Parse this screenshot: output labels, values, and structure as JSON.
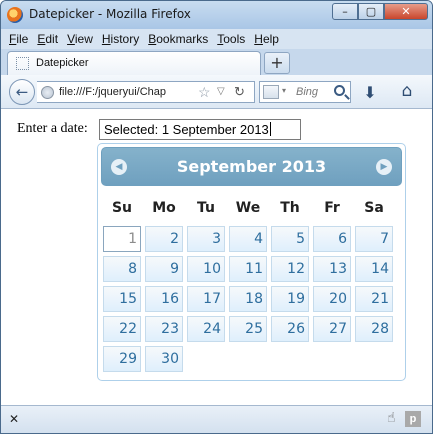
{
  "window": {
    "title": "Datepicker - Mozilla Firefox",
    "buttons": {
      "minimize": "–",
      "maximize": "▢",
      "close": "✕"
    }
  },
  "menubar": {
    "items": [
      {
        "label": "File",
        "accel": "F",
        "rest": "ile"
      },
      {
        "label": "Edit",
        "accel": "E",
        "rest": "dit"
      },
      {
        "label": "View",
        "accel": "V",
        "rest": "iew"
      },
      {
        "label": "History",
        "accel": "H",
        "rest": "istory"
      },
      {
        "label": "Bookmarks",
        "accel": "B",
        "rest": "ookmarks"
      },
      {
        "label": "Tools",
        "accel": "T",
        "rest": "ools"
      },
      {
        "label": "Help",
        "accel": "H",
        "rest": "elp"
      }
    ]
  },
  "tabs": {
    "active_label": "Datepicker",
    "new_tab": "+"
  },
  "navbar": {
    "back": "←",
    "url": "file:///F:/jqueryui/Chap",
    "star": "☆",
    "dropdown": "▽",
    "reload": "↻",
    "search_dropdown": "▾",
    "search_placeholder": "Bing",
    "download": "⬇",
    "home": "⌂"
  },
  "form": {
    "label": "Enter a date:",
    "value": "Selected: 1 September 2013"
  },
  "datepicker": {
    "title": "September 2013",
    "prev": "◀",
    "next": "▶",
    "weekdays": [
      "Su",
      "Mo",
      "Tu",
      "We",
      "Th",
      "Fr",
      "Sa"
    ],
    "selected_day": 1,
    "weeks": [
      [
        "1",
        "2",
        "3",
        "4",
        "5",
        "6",
        "7"
      ],
      [
        "8",
        "9",
        "10",
        "11",
        "12",
        "13",
        "14"
      ],
      [
        "15",
        "16",
        "17",
        "18",
        "19",
        "20",
        "21"
      ],
      [
        "22",
        "23",
        "24",
        "25",
        "26",
        "27",
        "28"
      ],
      [
        "29",
        "30"
      ]
    ]
  },
  "statusbar": {
    "close": "✕",
    "hand": "☝",
    "addon": "p"
  }
}
